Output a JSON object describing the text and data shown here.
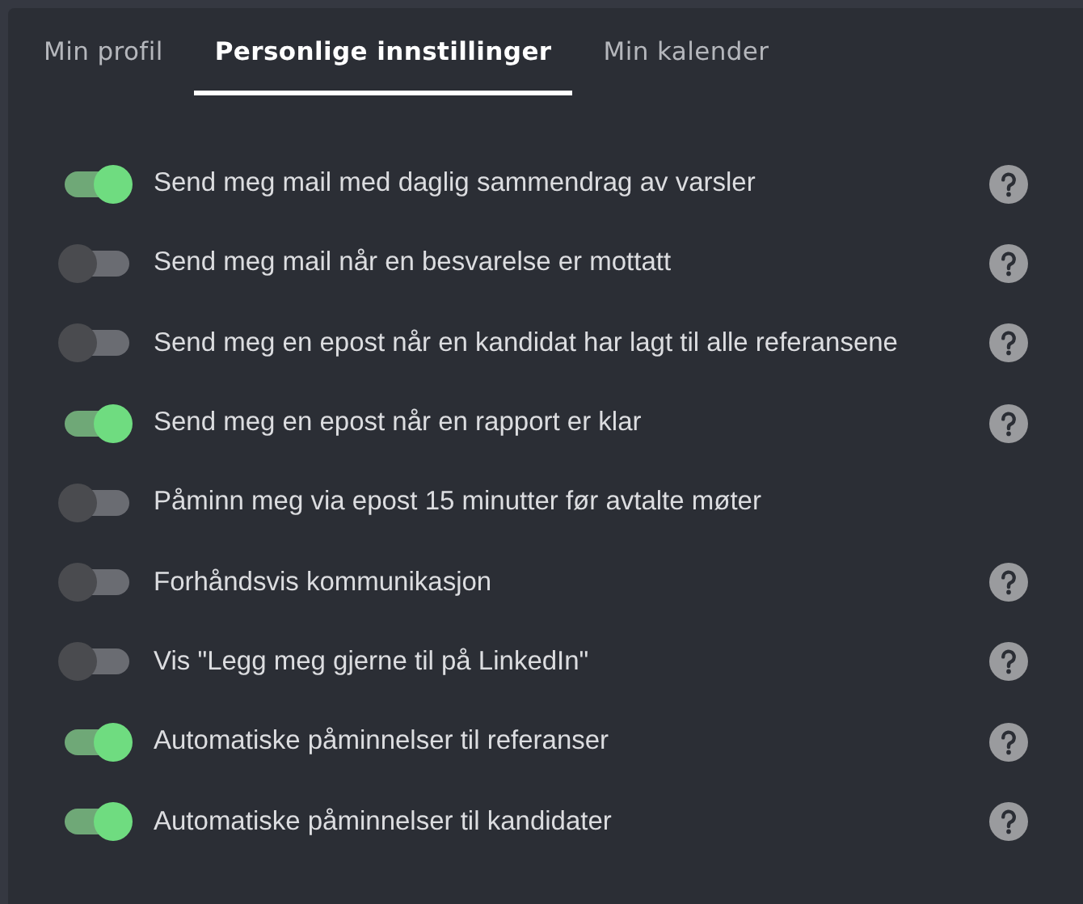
{
  "tabs": [
    {
      "label": "Min profil",
      "selected": false
    },
    {
      "label": "Personlige innstillinger",
      "selected": true
    },
    {
      "label": "Min kalender",
      "selected": false
    }
  ],
  "settings": [
    {
      "label": "Send meg mail med daglig sammendrag av varsler",
      "on": true,
      "help": true
    },
    {
      "label": "Send meg mail når en besvarelse er mottatt",
      "on": false,
      "help": true
    },
    {
      "label": "Send meg en epost når en kandidat har lagt til alle referansene",
      "on": false,
      "help": true
    },
    {
      "label": "Send meg en epost når en rapport er klar",
      "on": true,
      "help": true
    },
    {
      "label": "Påminn meg via epost 15 minutter før avtalte møter",
      "on": false,
      "help": false
    },
    {
      "label": "Forhåndsvis kommunikasjon",
      "on": false,
      "help": true
    },
    {
      "label": "Vis \"Legg meg gjerne til på LinkedIn\"",
      "on": false,
      "help": true
    },
    {
      "label": "Automatiske påminnelser til referanser",
      "on": true,
      "help": true
    },
    {
      "label": "Automatiske påminnelser til kandidater",
      "on": true,
      "help": true
    }
  ]
}
